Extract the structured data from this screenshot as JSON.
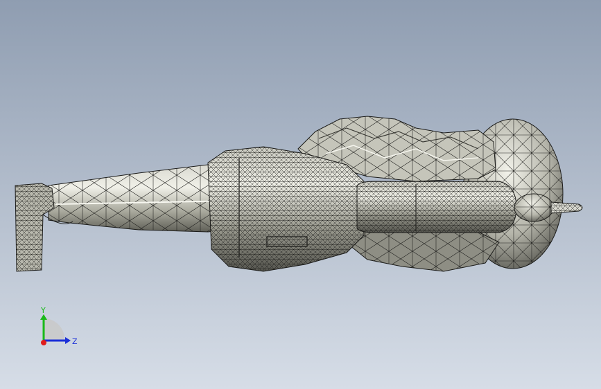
{
  "viewport": {
    "background_top": "#8f9db1",
    "background_bottom": "#d6dde7"
  },
  "model": {
    "surface_light": "#e8e8df",
    "surface_mid": "#b9b9ad",
    "surface_dark": "#6c6c63",
    "edge": "#1a1a18"
  },
  "triad": {
    "y_label": "Y",
    "z_label": "Z",
    "y_color": "#19b919",
    "z_color": "#1b2fd8",
    "x_color": "#e01c1c"
  }
}
